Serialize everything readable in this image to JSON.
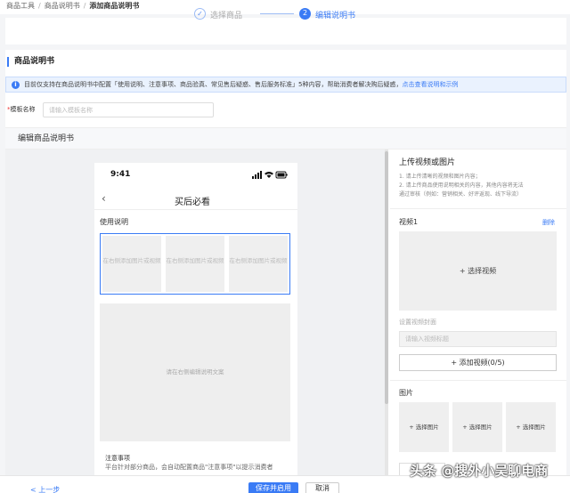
{
  "breadcrumb": {
    "items": [
      "商品工具",
      "商品说明书",
      "添加商品说明书"
    ],
    "separator": "/"
  },
  "steps": [
    {
      "number": "✓",
      "label": "选择商品",
      "state": "done"
    },
    {
      "number": "2",
      "label": "编辑说明书",
      "state": "active"
    }
  ],
  "section_title": "商品说明书",
  "info_bar": {
    "text": "目前仅支持在商品说明书中配置「使用说明、注意事项、商品验真、常见售后疑惑、售后服务标准」5种内容，帮助消费者解决购后疑惑，",
    "link": "点击查看说明和示例",
    "icon": "info-icon"
  },
  "template": {
    "required_mark": "*",
    "label": "模板名称",
    "placeholder": "请输入模板名称",
    "value": ""
  },
  "edit_header": "编辑商品说明书",
  "phone": {
    "time": "9:41",
    "back_icon": "back-arrow-icon",
    "title": "买后必看",
    "usage_title": "使用说明",
    "media_slots": [
      "在右侧添加图片或视频",
      "在右侧添加图片或视频",
      "在右侧添加图片或视频"
    ],
    "text_placeholder": "请在右侧编辑说明文案",
    "notice_title": "注意事项",
    "notice_text": "平台针对部分商品，会自动配置商品\"注意事项\"以提示消费者"
  },
  "right_panel": {
    "title": "上传视频或图片",
    "tips": [
      "1. 请上传清晰的视频和图片内容；",
      "2. 请上传商品使用说明相关的内容，其他内容将无法",
      "通过审核（例如：营销相关、好评返现、线下导流）"
    ],
    "video_label": "视频1",
    "video_delete": "删除",
    "video_select": "+ 选择视频",
    "cover_label": "设置视频封面",
    "video_title_placeholder": "请输入视频标题",
    "add_video": "+ 添加视频(0/5)",
    "image_label": "图片",
    "image_slots": [
      "+ 选择图片",
      "+ 选择图片",
      "+ 选择图片"
    ]
  },
  "footer": {
    "prev": "< 上一步",
    "save": "保存并启用",
    "cancel": "取消"
  },
  "watermark": "头条 @搜外小吴聊电商",
  "colors": {
    "accent": "#3a7bf5",
    "info_bg": "#eaf2fe",
    "placeholder_bg": "#efefef"
  }
}
